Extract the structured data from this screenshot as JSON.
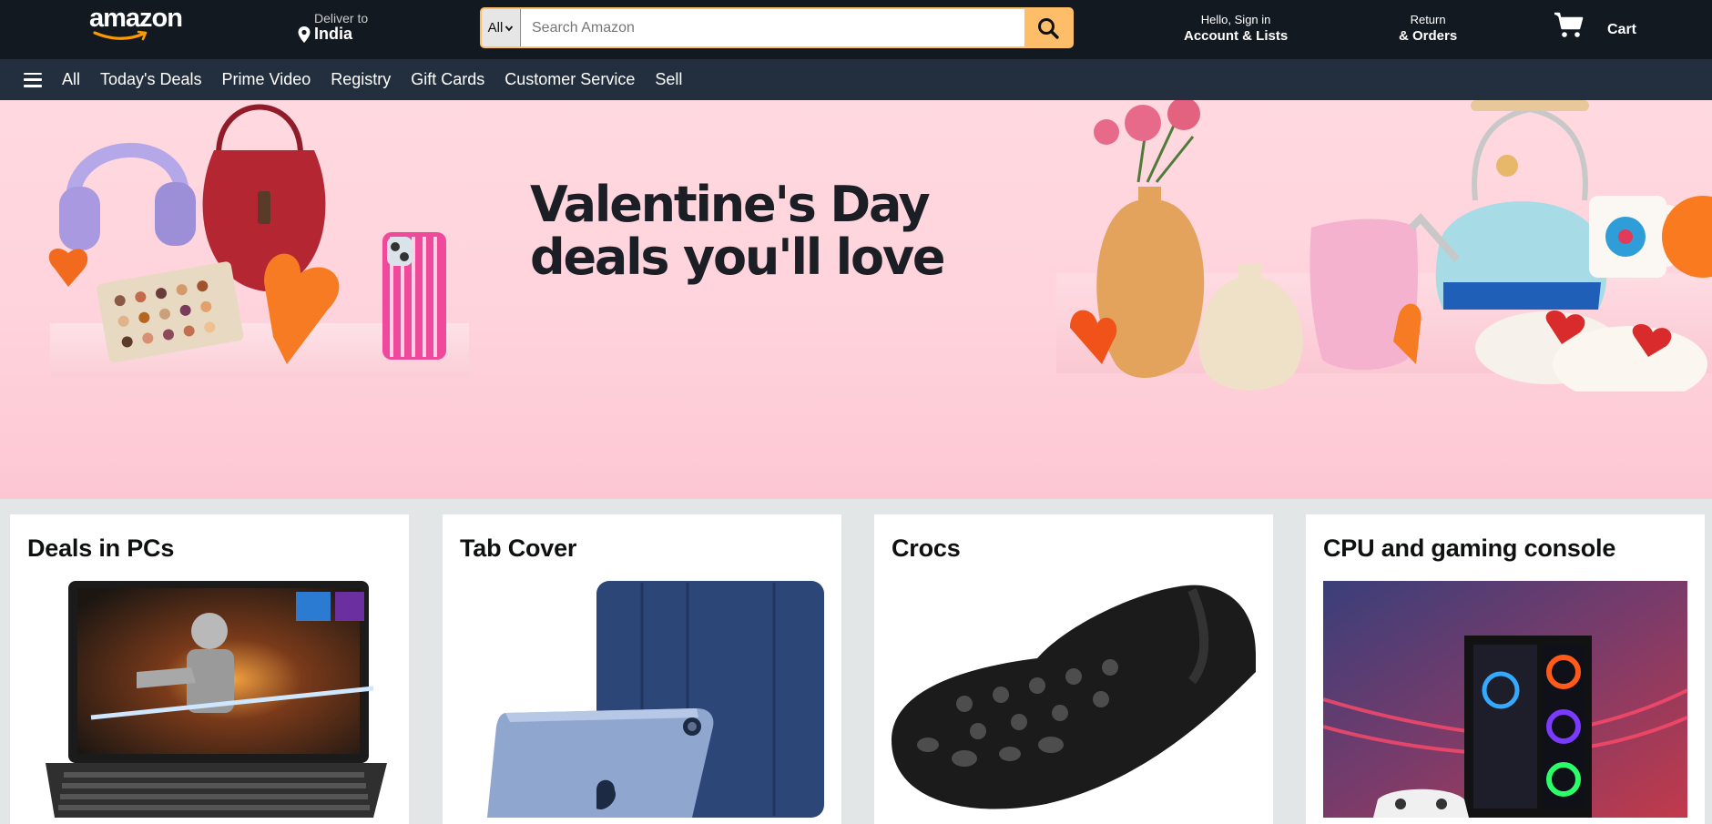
{
  "header": {
    "logo_text": "amazon",
    "deliver_line1": "Deliver to",
    "deliver_line2": "India",
    "search_category": "All",
    "search_placeholder": "Search Amazon",
    "account_line1": "Hello, Sign in",
    "account_line2": "Account & Lists",
    "returns_line1": "Return",
    "returns_line2": "& Orders",
    "cart_label": "Cart"
  },
  "nav": {
    "items": [
      "All",
      "Today's Deals",
      "Prime Video",
      "Registry",
      "Gift Cards",
      "Customer Service",
      "Sell"
    ]
  },
  "hero": {
    "title_line1": "Valentine's Day",
    "title_line2": "deals you'll love"
  },
  "cards": [
    {
      "title": "Deals in PCs"
    },
    {
      "title": "Tab Cover"
    },
    {
      "title": "Crocs"
    },
    {
      "title": "CPU and gaming console"
    }
  ],
  "colors": {
    "header_bg": "#131921",
    "nav_bg": "#232f3e",
    "search_button": "#febd69",
    "hero_bg": "#ffd9e0",
    "page_bg": "#e3e6e6"
  },
  "icons": {
    "location": "location-pin-icon",
    "search": "magnifier-icon",
    "cart": "shopping-cart-icon",
    "menu": "hamburger-menu-icon",
    "dropdown": "chevron-down-icon"
  }
}
